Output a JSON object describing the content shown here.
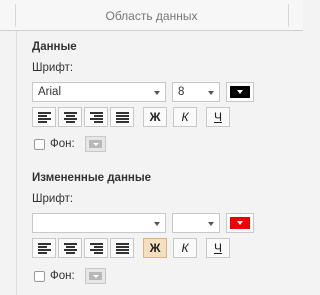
{
  "panel": {
    "title": "Область данных"
  },
  "data_section": {
    "heading": "Данные",
    "font_label": "Шрифт:",
    "font_name": "Arial",
    "font_size": "8",
    "font_color": "#000000",
    "bold_label": "Ж",
    "italic_label": "К",
    "underline_label": "Ч",
    "bold_active": false,
    "fill_label": "Фон:",
    "fill_checked": false
  },
  "changed_section": {
    "heading": "Измененные данные",
    "font_label": "Шрифт:",
    "font_name": "",
    "font_size": "",
    "font_color": "#ee0000",
    "bold_label": "Ж",
    "italic_label": "К",
    "underline_label": "Ч",
    "bold_active": true,
    "fill_label": "Фон:",
    "fill_checked": false
  }
}
